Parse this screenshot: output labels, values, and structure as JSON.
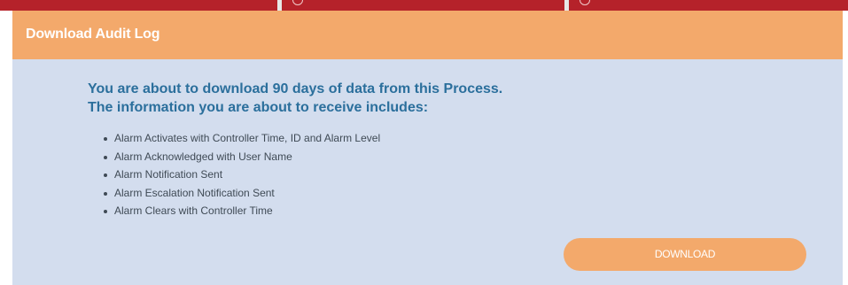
{
  "dialog": {
    "title": "Download Audit Log",
    "intro_line1": "You are about to download 90 days of data from this Process.",
    "intro_line2": "The information you are about to receive includes:",
    "items": [
      "Alarm Activates with Controller Time, ID and Alarm Level",
      "Alarm Acknowledged with User Name",
      "Alarm Notification Sent",
      "Alarm Escalation Notification Sent",
      "Alarm Clears with Controller Time"
    ],
    "download_label": "DOWNLOAD"
  },
  "colors": {
    "header": "#f3a96b",
    "body": "#d3ddee",
    "intro_text": "#2b6f9c",
    "background_strip": "#b5222a"
  }
}
